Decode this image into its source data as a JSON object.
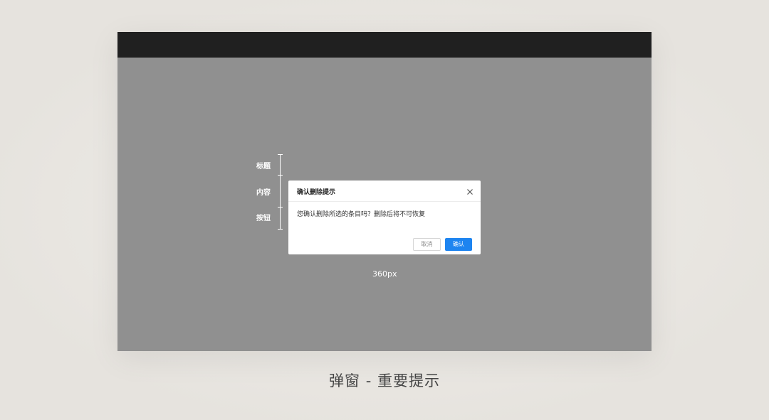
{
  "dialog": {
    "title": "确认删除提示",
    "close_icon": "close-icon",
    "message": "您确认删除所选的条目吗？删除后将不可恢复",
    "cancel_label": "取消",
    "confirm_label": "确认"
  },
  "annotations": {
    "title_label": "标题",
    "content_label": "内容",
    "button_label": "按钮",
    "width_label": "360px"
  },
  "caption": "弹窗 - 重要提示",
  "colors": {
    "page_background": "#e8e5e0",
    "titlebar": "#202020",
    "overlay": "#909090",
    "primary_button": "#1d84f0"
  }
}
